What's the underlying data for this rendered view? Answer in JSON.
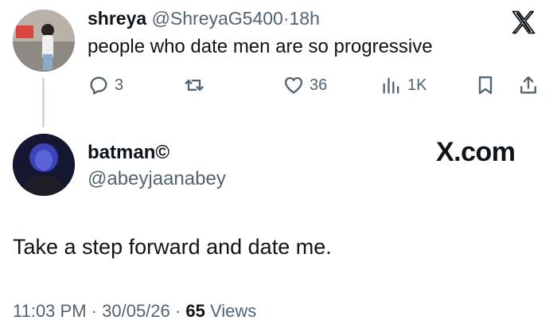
{
  "tweet1": {
    "name": "shreya",
    "handle": "@ShreyaG5400",
    "separator": "·",
    "age": "18h",
    "text": "people who date men are so progressive",
    "actions": {
      "reply_count": "3",
      "like_count": "36",
      "view_count": "1K"
    }
  },
  "tweet2": {
    "name": "batman©",
    "handle": "@abeyjaanabey",
    "watermark": "X.com",
    "text": "Take a step forward and date me.",
    "meta": {
      "time": "11:03 PM",
      "sep1": "·",
      "date": "30/05/26",
      "sep2": "·",
      "views_count": "65",
      "views_label": "Views"
    }
  },
  "icons": {
    "reply": "reply-icon",
    "retweet": "retweet-icon",
    "like": "heart-icon",
    "views": "views-icon",
    "bookmark": "bookmark-icon",
    "share": "share-icon",
    "logo": "x-logo-icon"
  },
  "colors": {
    "text": "#0f1419",
    "secondary": "#536471",
    "thread_line": "#cfd9de"
  }
}
